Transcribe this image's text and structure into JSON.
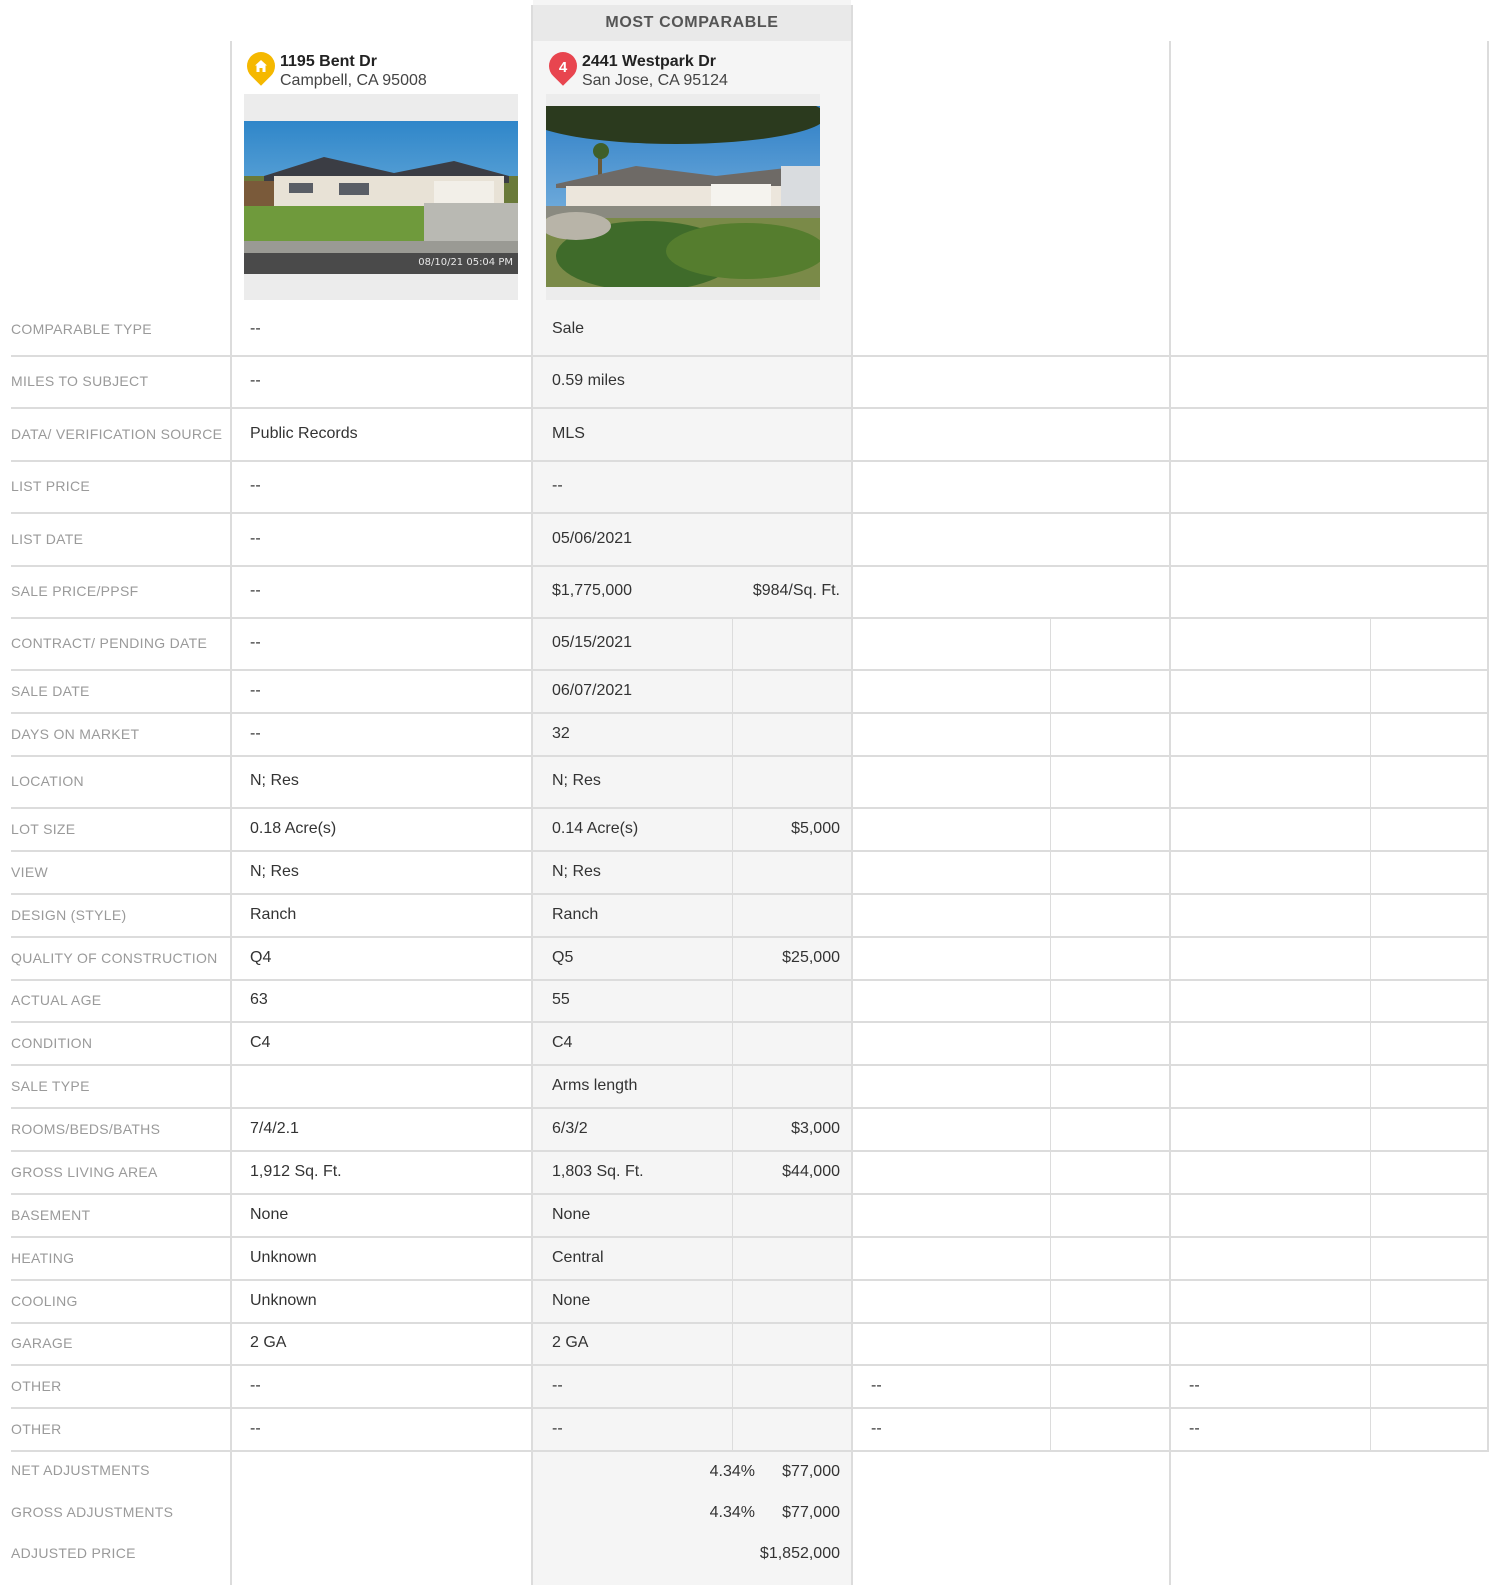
{
  "header": {
    "most_comparable": "MOST COMPARABLE"
  },
  "subject": {
    "address_line1": "1195 Bent Dr",
    "address_line2": "Campbell, CA 95008",
    "pin_icon": "home-icon",
    "pin_color": "#f5b800",
    "photo_timestamp": "08/10/21 05:04 PM"
  },
  "comparable": {
    "number": "4",
    "address_line1": "2441 Westpark Dr",
    "address_line2": "San Jose, CA 95124",
    "pin_color": "#e8454f"
  },
  "rows": [
    {
      "label": "COMPARABLE TYPE",
      "subject": "--",
      "comp": "Sale",
      "adj": ""
    },
    {
      "label": "MILES TO SUBJECT",
      "subject": "--",
      "comp": "0.59 miles",
      "adj": ""
    },
    {
      "label": "DATA/ VERIFICATION SOURCE",
      "subject": "Public Records",
      "comp": "MLS",
      "adj": ""
    },
    {
      "label": "LIST PRICE",
      "subject": "--",
      "comp": "--",
      "adj": ""
    },
    {
      "label": "LIST DATE",
      "subject": "--",
      "comp": "05/06/2021",
      "adj": ""
    },
    {
      "label": "SALE PRICE/PPSF",
      "subject": "--",
      "comp": "$1,775,000",
      "adj": "$984/Sq. Ft."
    },
    {
      "label": "CONTRACT/ PENDING DATE",
      "subject": "--",
      "comp": "05/15/2021",
      "adj": ""
    },
    {
      "label": "SALE DATE",
      "subject": "--",
      "comp": "06/07/2021",
      "adj": ""
    },
    {
      "label": "DAYS ON MARKET",
      "subject": "--",
      "comp": "32",
      "adj": ""
    },
    {
      "label": "LOCATION",
      "subject": "N; Res",
      "comp": "N; Res",
      "adj": ""
    },
    {
      "label": "LOT SIZE",
      "subject": "0.18 Acre(s)",
      "comp": "0.14 Acre(s)",
      "adj": "$5,000"
    },
    {
      "label": "VIEW",
      "subject": "N; Res",
      "comp": "N; Res",
      "adj": ""
    },
    {
      "label": "DESIGN (STYLE)",
      "subject": "Ranch",
      "comp": "Ranch",
      "adj": ""
    },
    {
      "label": "QUALITY OF CONSTRUCTION",
      "subject": "Q4",
      "comp": "Q5",
      "adj": "$25,000"
    },
    {
      "label": "ACTUAL AGE",
      "subject": "63",
      "comp": "55",
      "adj": ""
    },
    {
      "label": "CONDITION",
      "subject": "C4",
      "comp": "C4",
      "adj": ""
    },
    {
      "label": "SALE TYPE",
      "subject": "",
      "comp": "Arms length",
      "adj": ""
    },
    {
      "label": "ROOMS/BEDS/BATHS",
      "subject": "7/4/2.1",
      "comp": "6/3/2",
      "adj": "$3,000"
    },
    {
      "label": "GROSS LIVING AREA",
      "subject": "1,912 Sq. Ft.",
      "comp": "1,803 Sq. Ft.",
      "adj": "$44,000"
    },
    {
      "label": "BASEMENT",
      "subject": "None",
      "comp": "None",
      "adj": ""
    },
    {
      "label": "HEATING",
      "subject": "Unknown",
      "comp": "Central",
      "adj": ""
    },
    {
      "label": "COOLING",
      "subject": "Unknown",
      "comp": "None",
      "adj": ""
    },
    {
      "label": "GARAGE",
      "subject": "2 GA",
      "comp": "2 GA",
      "adj": ""
    },
    {
      "label": "OTHER",
      "subject": "--",
      "comp": "--",
      "adj": "",
      "col3": "--",
      "col4": "--"
    },
    {
      "label": "OTHER",
      "subject": "--",
      "comp": "--",
      "adj": "",
      "col3": "--",
      "col4": "--"
    }
  ],
  "summary": {
    "net_label": "NET ADJUSTMENTS",
    "net_pct": "4.34%",
    "net_amt": "$77,000",
    "gross_label": "GROSS ADJUSTMENTS",
    "gross_pct": "4.34%",
    "gross_amt": "$77,000",
    "adjusted_label": "ADJUSTED PRICE",
    "adjusted_amt": "$1,852,000"
  }
}
